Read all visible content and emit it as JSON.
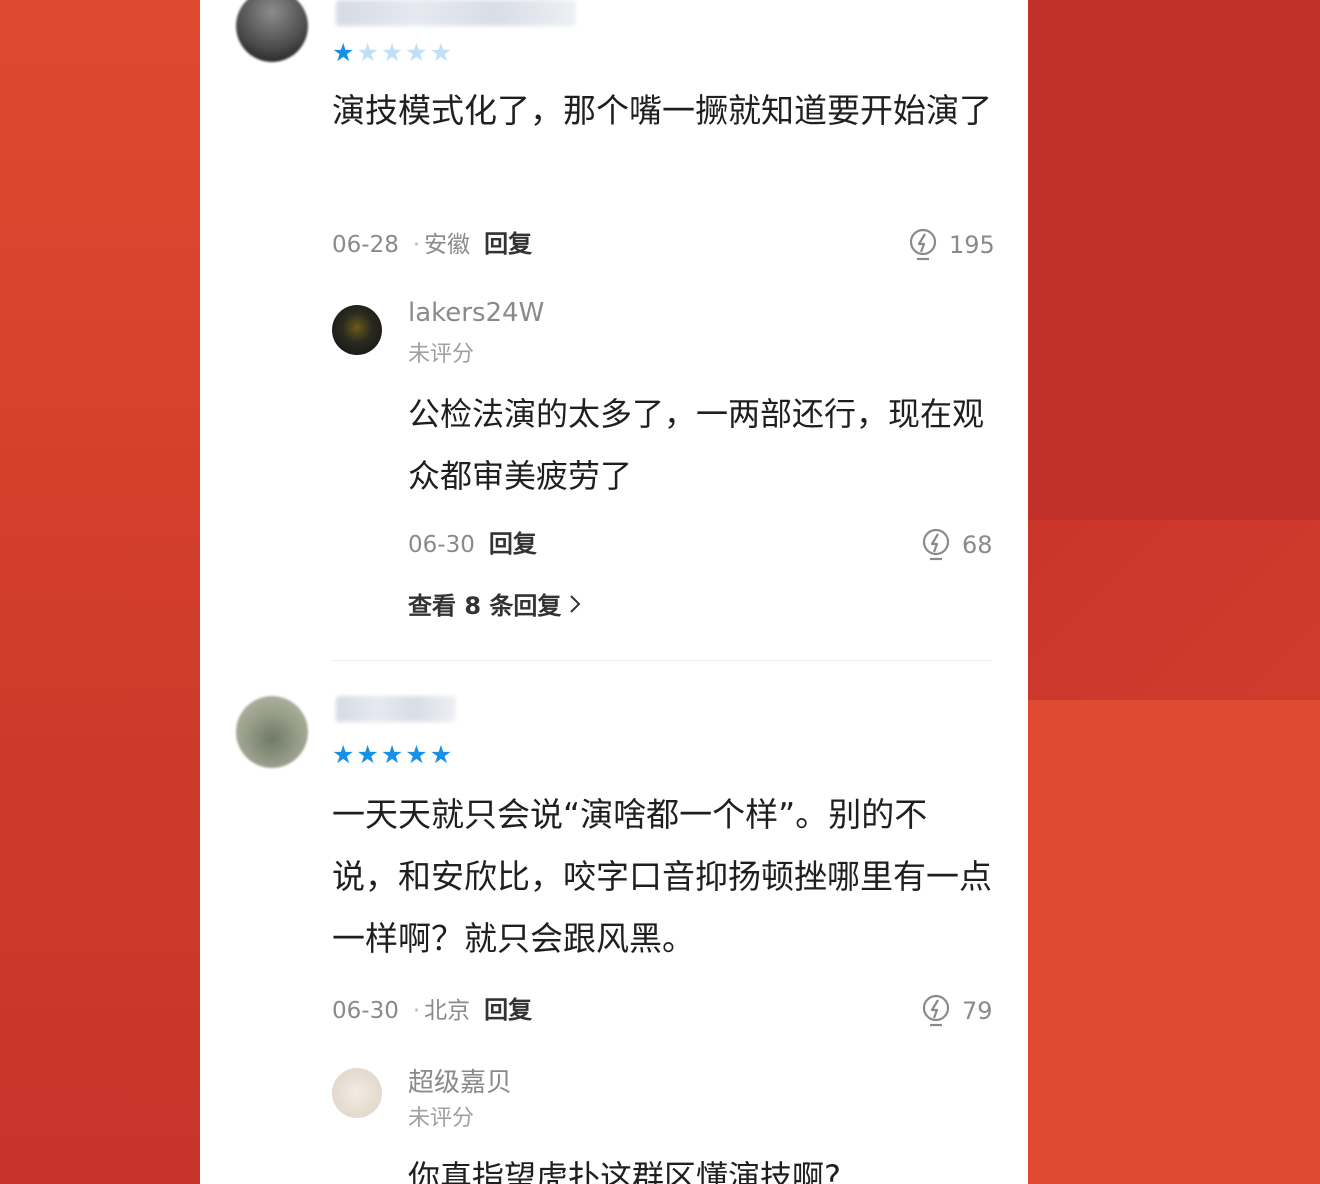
{
  "comments": [
    {
      "rating": 1,
      "text": "演技模式化了，那个嘴一撅就知道要开始演了",
      "date": "06-28",
      "location": "安徽",
      "reply_label": "回复",
      "likes": "195",
      "sub_reply": {
        "name": "lakers24W",
        "rating_label": "未评分",
        "text": "公检法演的太多了，一两部还行，现在观众都审美疲劳了",
        "date": "06-30",
        "reply_label": "回复",
        "likes": "68"
      },
      "more_replies": "查看 8 条回复"
    },
    {
      "rating": 5,
      "text": "一天天就只会说“演啥都一个样”。别的不说，和安欣比，咬字口音抑扬顿挫哪里有一点一样啊？就只会跟风黑。",
      "date": "06-30",
      "location": "北京",
      "reply_label": "回复",
      "likes": "79",
      "sub_reply": {
        "name": "超级嘉贝",
        "rating_label": "未评分",
        "text": "你真指望虎扑这群区懂演技啊?"
      }
    }
  ],
  "colors": {
    "star_on": "#1890e8",
    "star_off": "#bfe0f8",
    "background_red": "#d0402c"
  },
  "icons": {
    "like": "lightbulb-icon",
    "more": "chevron-right-icon",
    "star": "star-icon"
  }
}
